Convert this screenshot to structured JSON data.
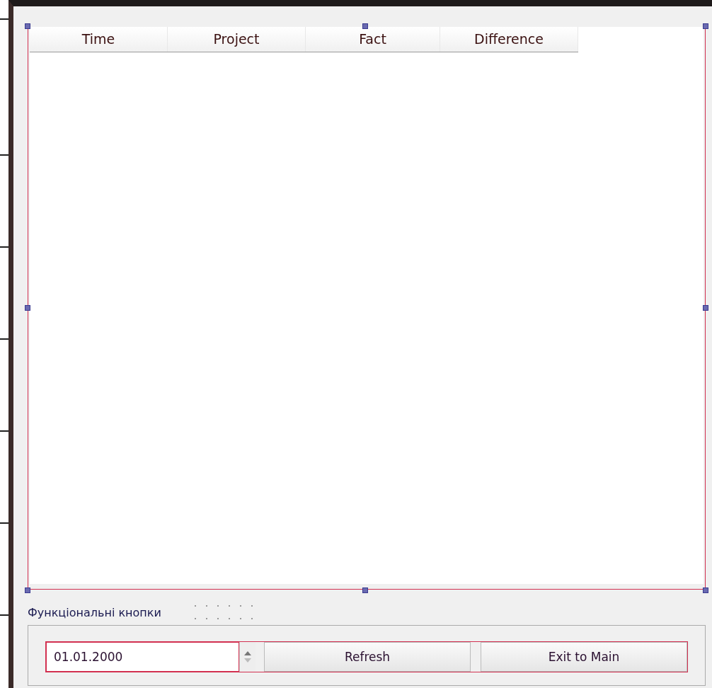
{
  "table": {
    "columns": [
      "Time",
      "Project",
      "Fact",
      "Difference"
    ]
  },
  "group_box": {
    "title": "Функціональні кнопки"
  },
  "date_edit": {
    "value": "01.01.2000"
  },
  "buttons": [
    "Refresh",
    "Exit to Main"
  ]
}
